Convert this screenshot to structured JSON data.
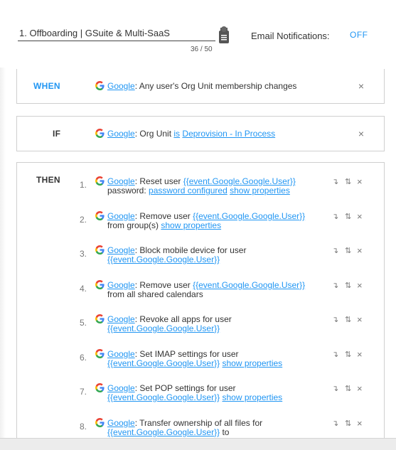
{
  "header": {
    "rule_title": "1. Offboarding | GSuite & Multi-SaaS",
    "char_count": "36 / 50",
    "email_notifications_label": "Email Notifications:",
    "email_notifications_value": "OFF"
  },
  "when": {
    "label": "WHEN",
    "service": "Google",
    "text": ": Any user's Org Unit membership changes"
  },
  "if": {
    "label": "IF",
    "service": "Google",
    "text_pre": ": Org Unit ",
    "operator": "is",
    "value": "Deprovision - In Process"
  },
  "then": {
    "label": "THEN",
    "actions": [
      {
        "num": "1.",
        "service": "Google",
        "text": ": Reset user ",
        "link1": "{{event.Google.Google.User}}",
        "line2_text": "password: ",
        "line2_link1": "password configured",
        "line2_link2": "show properties"
      },
      {
        "num": "2.",
        "service": "Google",
        "text": ": Remove user ",
        "link1": "{{event.Google.Google.User}}",
        "line2_text": "from group(s) ",
        "line2_link1": "show properties"
      },
      {
        "num": "3.",
        "service": "Google",
        "text": ": Block mobile device for user",
        "line2_link1": "{{event.Google.Google.User}}"
      },
      {
        "num": "4.",
        "service": "Google",
        "text": ": Remove user ",
        "link1": "{{event.Google.Google.User}}",
        "line2_text": "from all shared calendars"
      },
      {
        "num": "5.",
        "service": "Google",
        "text": ": Revoke all apps for user",
        "line2_link1": "{{event.Google.Google.User}}"
      },
      {
        "num": "6.",
        "service": "Google",
        "text": ": Set IMAP settings for user",
        "line2_link1": "{{event.Google.Google.User}}",
        "line2_link2": "show properties"
      },
      {
        "num": "7.",
        "service": "Google",
        "text": ": Set POP settings for user",
        "line2_link1": "{{event.Google.Google.User}}",
        "line2_link2": "show properties"
      },
      {
        "num": "8.",
        "service": "Google",
        "text": ": Transfer ownership of all files for",
        "line2_link1": "{{event.Google.Google.User}}",
        "line2_text_after": " to"
      }
    ]
  },
  "icons": {
    "save": "save-file-icon",
    "google": "google-g-icon",
    "close": "close-icon",
    "indent": "indent-arrow-icon",
    "reorder": "reorder-arrows-icon"
  },
  "colors": {
    "accent": "#2196f3",
    "border": "#cfcfcf",
    "text": "#333333"
  }
}
